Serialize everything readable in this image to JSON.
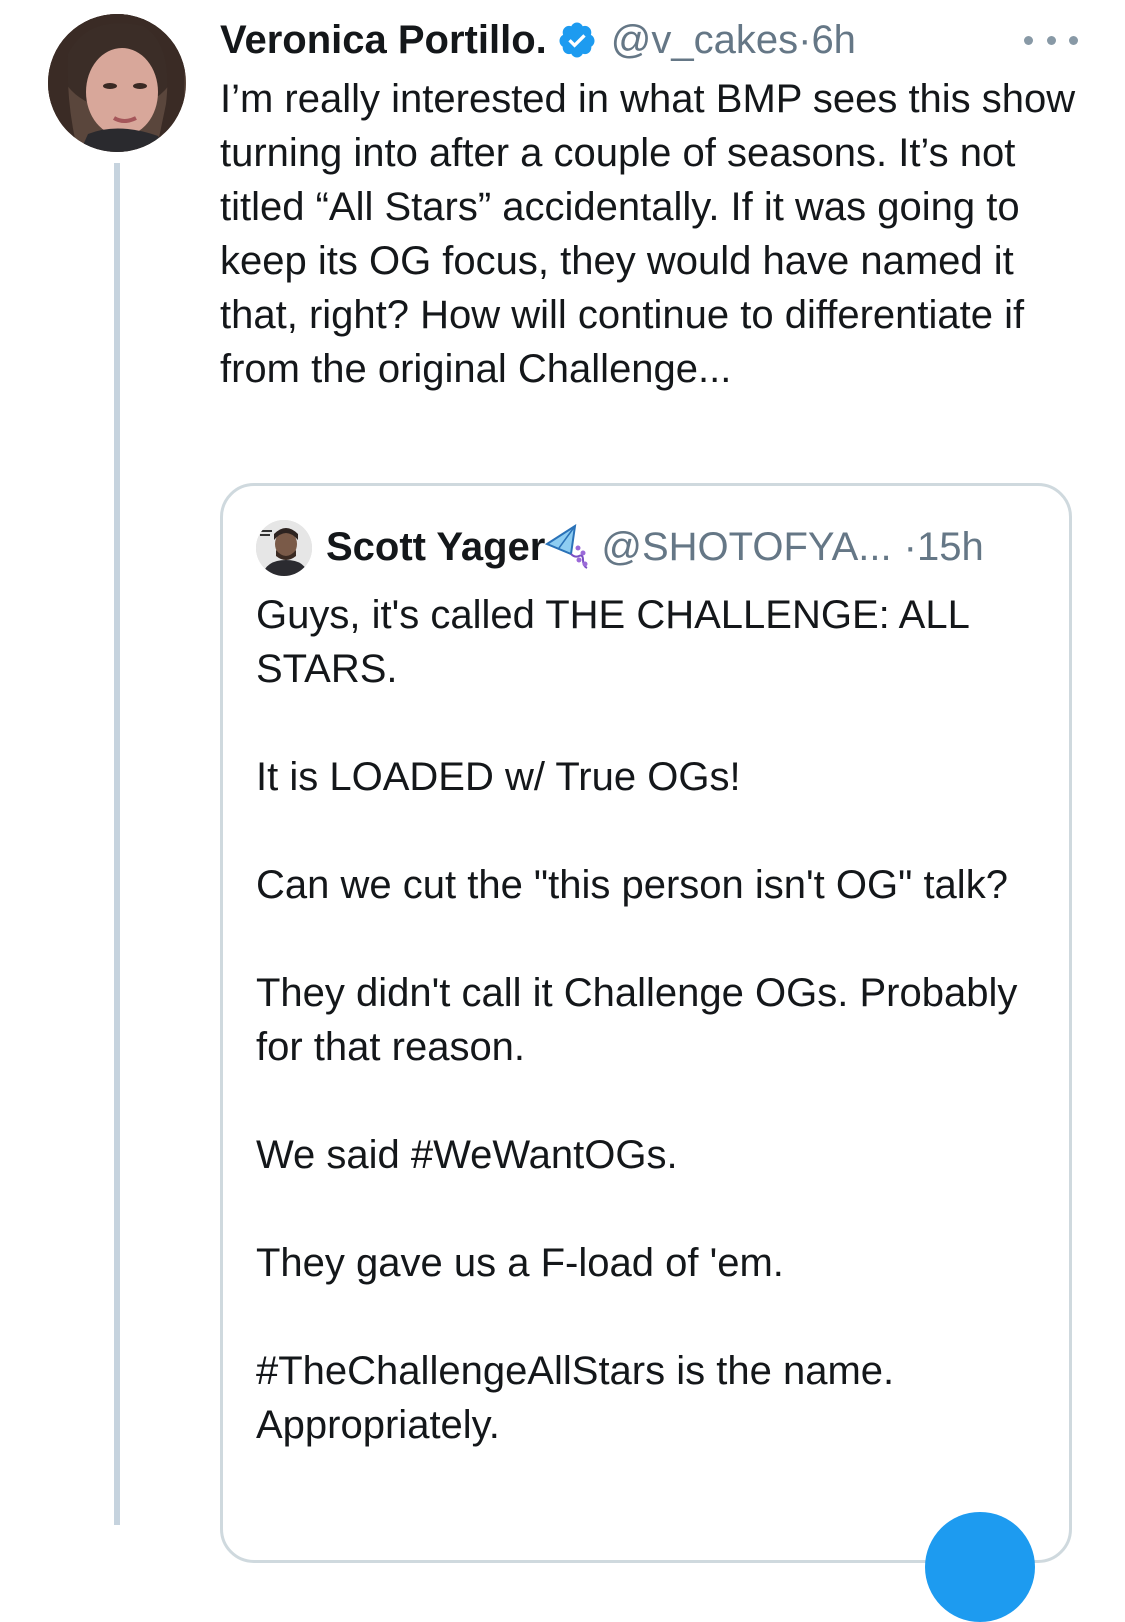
{
  "tweet": {
    "author_name": "Veronica Portillo.",
    "author_handle": "@v_cakes",
    "meta_separator": " · ",
    "time": "6h",
    "text": "I’m really interested in what BMP sees this show turning into after a couple of seasons. It’s not titled “All Stars” accidentally. If it was going to keep its OG focus, they would have named it that, right? How will continue to differentiate if from the original Challenge..."
  },
  "quoted_tweet": {
    "author_name": "Scott Yager",
    "author_handle": "@SHOTOFYA...",
    "meta_separator": " · ",
    "time": "15h",
    "paragraphs": [
      "Guys, it's called THE CHALLENGE: ALL STARS.",
      "It is LOADED w/ True OGs!",
      "Can we cut the \"this person isn't OG\" talk?",
      "They didn't call it Challenge OGs. Probably for that reason.",
      "We said #WeWantOGs.",
      "They gave us a F-load of 'em.",
      "#TheChallengeAllStars is the name. Appropriately."
    ]
  },
  "icons": {
    "verified": "verified-badge-icon",
    "more": "more-options-icon",
    "kite": "kite-emoji-icon"
  },
  "colors": {
    "verified_blue": "#1d9bf0",
    "secondary_text": "#657786",
    "thread_line": "#c6d3de",
    "card_border": "#cfd9de"
  }
}
